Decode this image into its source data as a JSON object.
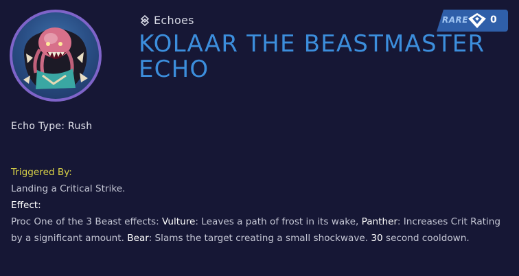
{
  "header": {
    "category_icon": "echo-icon",
    "category": "Echoes",
    "title_line1": "KOLAAR THE BEASTMASTER",
    "title_line2": "ECHO"
  },
  "rarity": {
    "label": "RARE",
    "icon": "gem-icon",
    "count": "0",
    "color": "#2f5fa9"
  },
  "avatar": {
    "icon": "creature-portrait",
    "ring_color": "#7f64c9"
  },
  "echo_type": "Echo Type: Rush",
  "description": {
    "triggered_by_label": "Triggered By:",
    "triggered_by_text": "Landing a Critical Strike.",
    "effect_label": "Effect:",
    "effect_intro": "Proc One of the 3 Beast effects: ",
    "vulture_name": "Vulture",
    "vulture_text": ": Leaves a path of frost in its wake, ",
    "panther_name": "Panther",
    "panther_text": ": Increases Crit Rating by a significant amount. ",
    "bear_name": "Bear",
    "bear_text": ": Slams the target creating a small shockwave. ",
    "cooldown_value": "30",
    "cooldown_text": " second cooldown."
  },
  "colors": {
    "background": "#161735",
    "title": "#3c8edc",
    "trigger_label": "#d9d247"
  }
}
